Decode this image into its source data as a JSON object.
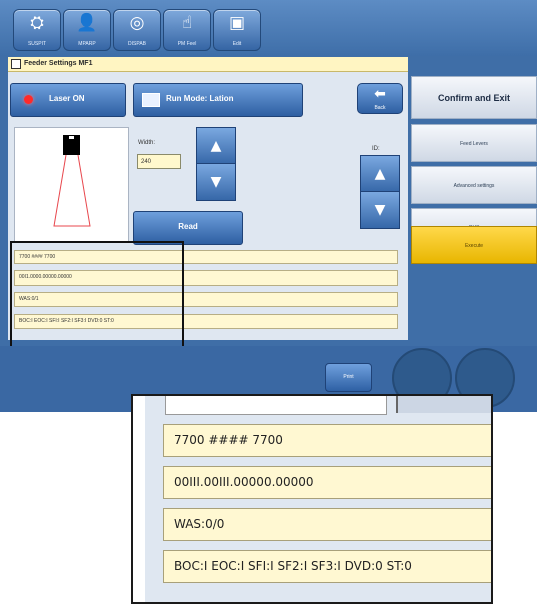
{
  "toolbar": {
    "buttons": [
      {
        "label": "SUSPIT",
        "icon": "machine-icon",
        "glyph": "⛭"
      },
      {
        "label": "MPARP",
        "icon": "user-icon",
        "glyph": "👤"
      },
      {
        "label": "DISPAB",
        "icon": "binoculars-icon",
        "glyph": "◎"
      },
      {
        "label": "PM Feel",
        "icon": "hand-icon",
        "glyph": "☝"
      },
      {
        "label": "Edit",
        "icon": "save-icon",
        "glyph": "▣"
      }
    ]
  },
  "title": "Feeder Settings MF1",
  "controls": {
    "laser_label": "Laser ON",
    "run_mode_label": "Run Mode: Lation",
    "back_label": "Back",
    "width_label": "Width:",
    "width_value": "240",
    "read_label": "Read",
    "id_label": "ID:",
    "arrow_up": "▲",
    "arrow_down": "▼",
    "back_glyph": "⬅"
  },
  "data_rows": [
    "7700 #### 7700",
    "00I1.0000.00000.00000",
    "WAS:0/1",
    "BOC:I EOC:I SFI:I SF2:I SF3:I DVD:0 ST:0"
  ],
  "sidebar": {
    "confirm": "Confirm and Exit",
    "items": [
      "Feed Levers",
      "Advanced settings",
      "OHS",
      "Execute"
    ]
  },
  "bottom": {
    "print_label": "Print"
  },
  "zoom": {
    "rows": [
      "7700 #### 7700",
      "00III.00III.00000.00000",
      "WAS:0/0",
      "BOC:I EOC:I SFI:I SF2:I SF3:I DVD:0 ST:0"
    ]
  },
  "colors": {
    "accent": "#3f6ea7",
    "execute": "#f2c300",
    "field": "#fff8d2"
  }
}
